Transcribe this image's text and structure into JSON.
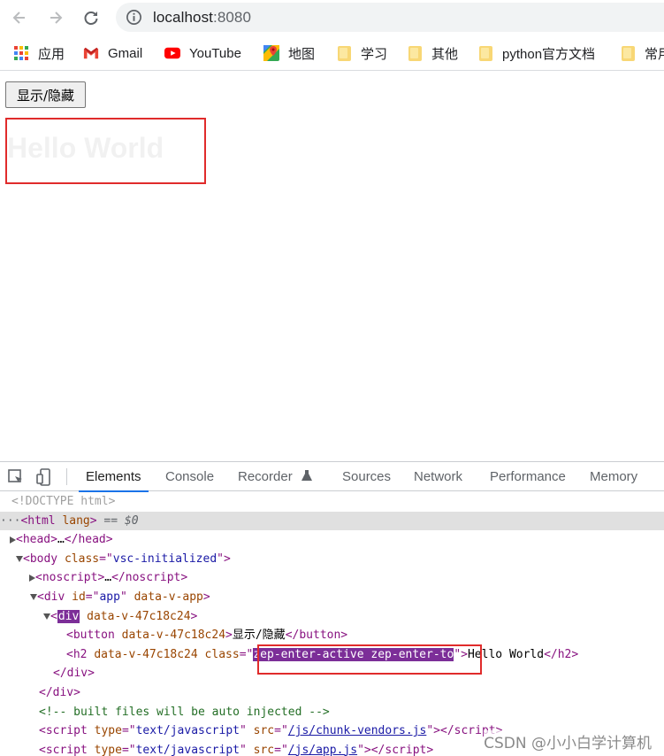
{
  "browser": {
    "url_host": "localhost",
    "url_port": ":8080"
  },
  "bookmarks": [
    {
      "label": "应用",
      "icon": "apps-grid-icon"
    },
    {
      "label": "Gmail",
      "icon": "gmail-icon"
    },
    {
      "label": "YouTube",
      "icon": "youtube-icon"
    },
    {
      "label": "地图",
      "icon": "maps-icon"
    },
    {
      "label": "学习",
      "icon": "folder-icon"
    },
    {
      "label": "其他",
      "icon": "folder-icon"
    },
    {
      "label": "python官方文档",
      "icon": "folder-icon"
    },
    {
      "label": "常用",
      "icon": "folder-icon"
    }
  ],
  "page": {
    "button_label": "显示/隐藏",
    "heading": "Hello World"
  },
  "devtools": {
    "tabs": [
      "Elements",
      "Console",
      "Recorder",
      "Sources",
      "Network",
      "Performance",
      "Memory"
    ],
    "active_tab": "Elements",
    "dom": {
      "doctype": "<!DOCTYPE html>",
      "html_open_prefix": "<html",
      "html_attr": "lang",
      "html_close": ">",
      "html_eq0": "== $0",
      "head": "…",
      "body_class": "vsc-initialized",
      "noscript": "…",
      "app_id": "app",
      "app_attr": "data-v-app",
      "inner_div_attr": "data-v-47c18c24",
      "button_attr": "data-v-47c18c24",
      "button_text": "显示/隐藏",
      "h2_attr": "data-v-47c18c24",
      "h2_class": "zep-enter-active zep-enter-to",
      "h2_text": "Hello World",
      "comment": "<!-- built files will be auto injected -->",
      "script1_type": "text/javascript",
      "script1_src": "/js/chunk-vendors.js",
      "script2_type": "text/javascript",
      "script2_src": "/js/app.js"
    }
  },
  "watermark": "CSDN @小小白学计算机",
  "colors": {
    "highlight_border": "#e02b2b",
    "selection": "#7c2e98",
    "active_tab_underline": "#1a73e8"
  }
}
